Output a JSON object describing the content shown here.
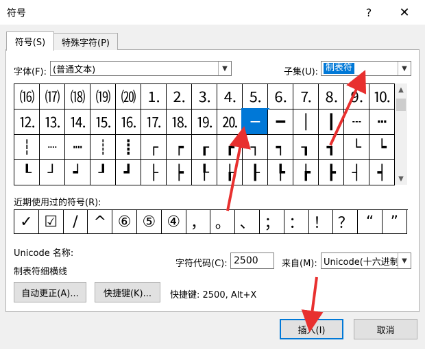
{
  "window": {
    "title": "符号",
    "help_label": "?",
    "close_label": "✕"
  },
  "tabs": [
    {
      "label": "符号(S)",
      "active": true
    },
    {
      "label": "特殊字符(P)",
      "active": false
    }
  ],
  "font": {
    "label": "字体(F):",
    "value": "(普通文本)"
  },
  "subset": {
    "label": "子集(U):",
    "value": "制表符"
  },
  "grid": [
    [
      "⒃",
      "⒄",
      "⒅",
      "⒆",
      "⒇",
      "⒈",
      "⒉",
      "⒊",
      "⒋",
      "⒌",
      "⒍",
      "⒎",
      "⒏",
      "⒐",
      "⒑"
    ],
    [
      "⒓",
      "⒔",
      "⒕",
      "⒖",
      "⒗",
      "⒘",
      "⒙",
      "⒚",
      "⒛",
      "─",
      "━",
      "│",
      "┃",
      "┄",
      "┅"
    ],
    [
      "┆",
      "┈",
      "┉",
      "┊",
      "┋",
      "┌",
      "┍",
      "┎",
      "┏",
      "┐",
      "┑",
      "┒",
      "┓",
      "└",
      "┕"
    ],
    [
      "┖",
      "┘",
      "┙",
      "┚",
      "┛",
      "├",
      "┝",
      "┞",
      "┟",
      "┠",
      "┡",
      "┢",
      "┣",
      "┤",
      "┥"
    ]
  ],
  "selected_symbol": "─",
  "recent": {
    "label": "近期使用过的符号(R):",
    "items": [
      "✓",
      "☑",
      "/",
      "^",
      "⑥",
      "⑤",
      "④",
      "，",
      "。",
      "、",
      "；",
      "：",
      "！",
      "？",
      "“",
      "”"
    ]
  },
  "unicode_name": {
    "label": "Unicode 名称:",
    "value": "制表符细横线"
  },
  "char_code": {
    "label": "字符代码(C):",
    "value": "2500"
  },
  "from": {
    "label": "来自(M):",
    "value": "Unicode(十六进制)"
  },
  "buttons": {
    "autocorrect": "自动更正(A)...",
    "shortcut": "快捷键(K)...",
    "insert": "插入(I)",
    "cancel": "取消"
  },
  "shortcut_info": "快捷键: 2500, Alt+X",
  "colors": {
    "accent": "#0078d7",
    "annotation_arrow": "#e8302f"
  }
}
